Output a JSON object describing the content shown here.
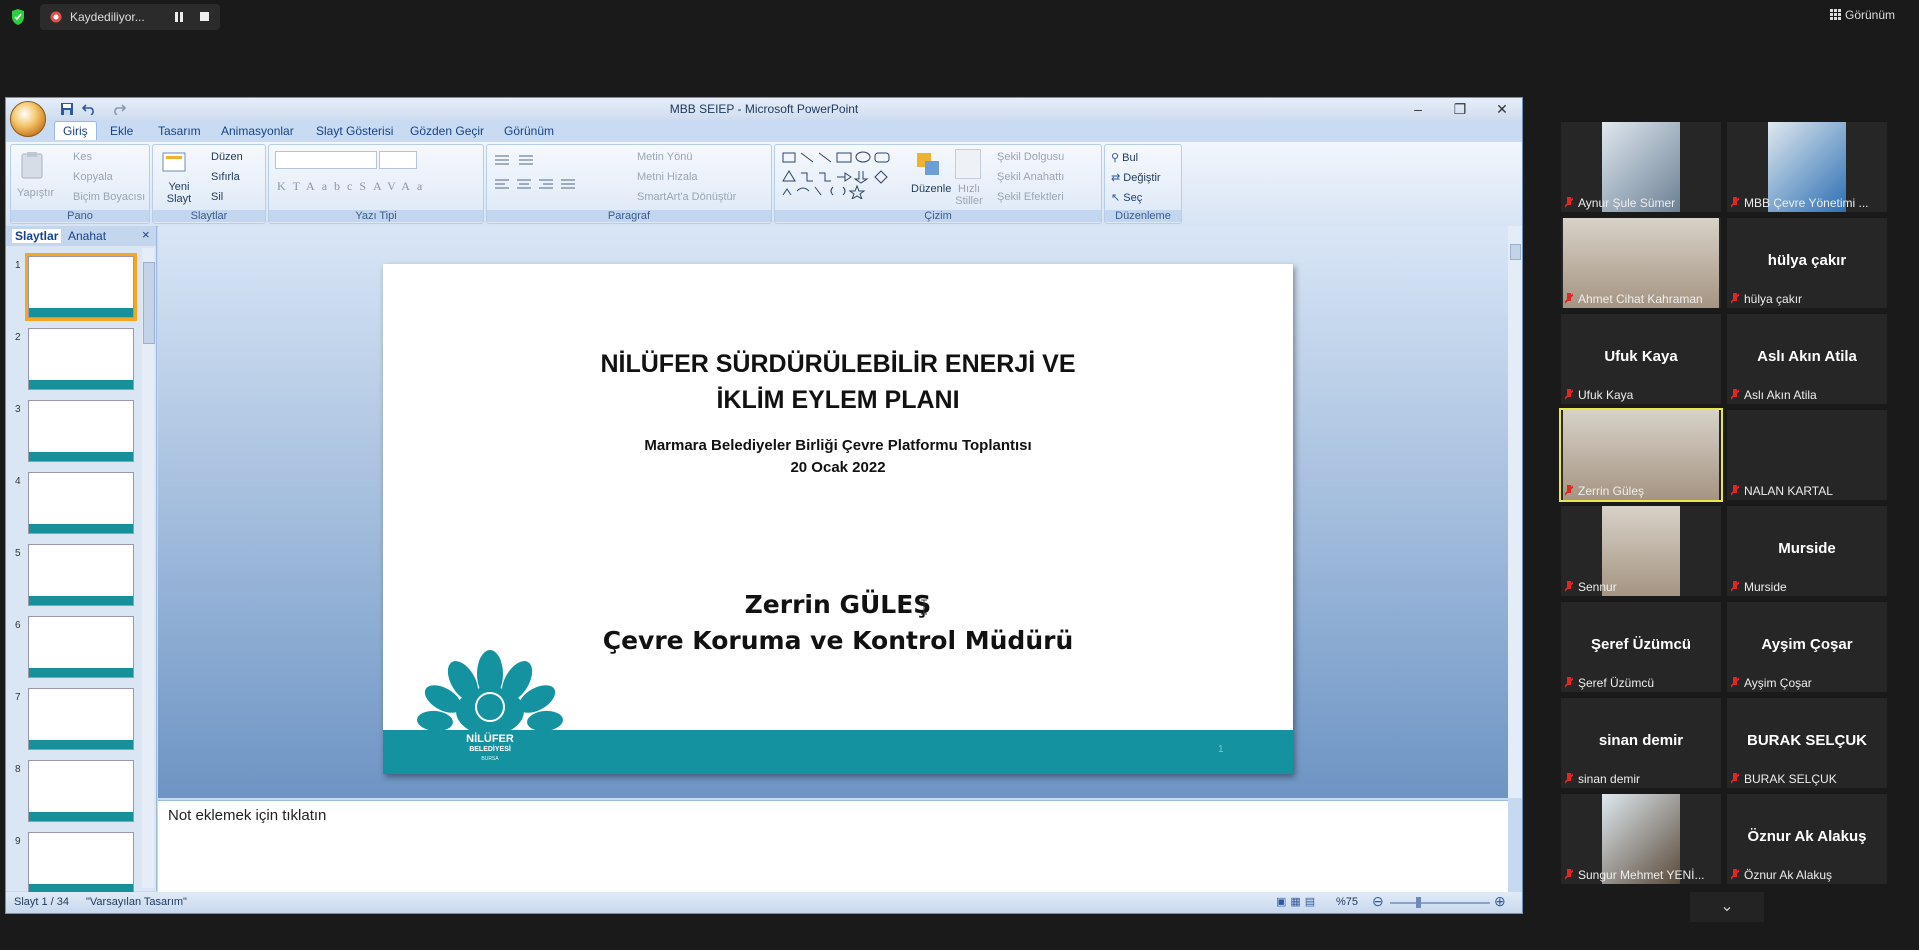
{
  "meeting": {
    "recording_label": "Kaydediliyor...",
    "view_label": "Görünüm",
    "colors": {
      "shield": "#2ecc40",
      "rec_icon": "#e05050",
      "highlight": "#e8e84a"
    }
  },
  "app": {
    "title": "MBB SEIEP - Microsoft PowerPoint",
    "window_controls": [
      "–",
      "❐",
      "✕"
    ],
    "tabs": [
      "Giriş",
      "Ekle",
      "Tasarım",
      "Animasyonlar",
      "Slayt Gösterisi",
      "Gözden Geçir",
      "Görünüm"
    ],
    "ribbon": {
      "groups": {
        "pano": "Pano",
        "slaytlar": "Slaytlar",
        "yazi_tipi": "Yazı Tipi",
        "paragraf": "Paragraf",
        "cizim": "Çizim",
        "duzenleme": "Düzenleme"
      },
      "pano": {
        "paste": "Yapıştır",
        "cut": "Kes",
        "copy": "Kopyala",
        "format_painter": "Biçim Boyacısı"
      },
      "slaytlar": {
        "new_slide": "Yeni Slayt",
        "layout": "Düzen",
        "reset": "Sıfırla",
        "delete": "Sil"
      },
      "paragraf": {
        "text_direction": "Metin Yönü",
        "align_text": "Metni Hizala",
        "smartart": "SmartArt'a Dönüştür"
      },
      "cizim": {
        "arrange": "Düzenle",
        "quick_styles": "Hızlı Stiller",
        "shape_fill": "Şekil Dolgusu",
        "shape_outline": "Şekil Anahattı",
        "shape_effects": "Şekil Efektleri"
      },
      "duzenleme": {
        "find": "Bul",
        "replace": "Değiştir",
        "select": "Seç"
      }
    },
    "pane_tabs": [
      "Slaytlar",
      "Anahat"
    ],
    "slide": {
      "title_line1": "NİLÜFER SÜRDÜRÜLEBİLİR ENERJİ VE",
      "title_line2": "İKLİM EYLEM PLANI",
      "subtitle_line1": "Marmara Belediyeler Birliği Çevre Platformu Toplantısı",
      "subtitle_line2": "20 Ocak 2022",
      "presenter_name": "Zerrin GÜLEŞ",
      "presenter_role": "Çevre Koruma ve Kontrol Müdürü",
      "logo_line1": "NİLÜFER",
      "logo_line2": "BELEDİYESİ",
      "logo_line3": "BURSA",
      "page_number": "1",
      "brand_color": "#1592a0"
    },
    "thumbnails": [
      "1",
      "2",
      "3",
      "4",
      "5",
      "6",
      "7",
      "8",
      "9"
    ],
    "notes_placeholder": "Not eklemek için tıklatın",
    "status": {
      "slide": "Slayt 1 / 34",
      "theme": "\"Varsayılan Tasarım\"",
      "zoom": "%75"
    }
  },
  "participants": [
    {
      "name": "Aynur Şule Sümer",
      "video": "image"
    },
    {
      "name": "MBB Çevre Yönetimi ...",
      "video": "image"
    },
    {
      "name": "Ahmet Cihat Kahraman",
      "video": "camera"
    },
    {
      "name": "hülya çakır",
      "display": "hülya çakır"
    },
    {
      "name": "Ufuk Kaya",
      "display": "Ufuk Kaya"
    },
    {
      "name": "Aslı Akın Atila",
      "display": "Aslı Akın Atila"
    },
    {
      "name": "Zerrin Güleş",
      "video": "camera",
      "speaking": true
    },
    {
      "name": "NALAN KARTAL",
      "display": ""
    },
    {
      "name": "Sennur",
      "video": "camera"
    },
    {
      "name": "Murside",
      "display": "Murside"
    },
    {
      "name": "Şeref Üzümcü",
      "display": "Şeref Üzümcü"
    },
    {
      "name": "Ayşim Çoşar",
      "display": "Ayşim Çoşar"
    },
    {
      "name": "sinan demir",
      "display": "sinan demir"
    },
    {
      "name": "BURAK SELÇUK",
      "display": "BURAK SELÇUK"
    },
    {
      "name": "Sungur Mehmet YENİ...",
      "video": "image"
    },
    {
      "name": "Öznur Ak Alakuş",
      "display": "Öznur Ak Alakuş"
    }
  ]
}
